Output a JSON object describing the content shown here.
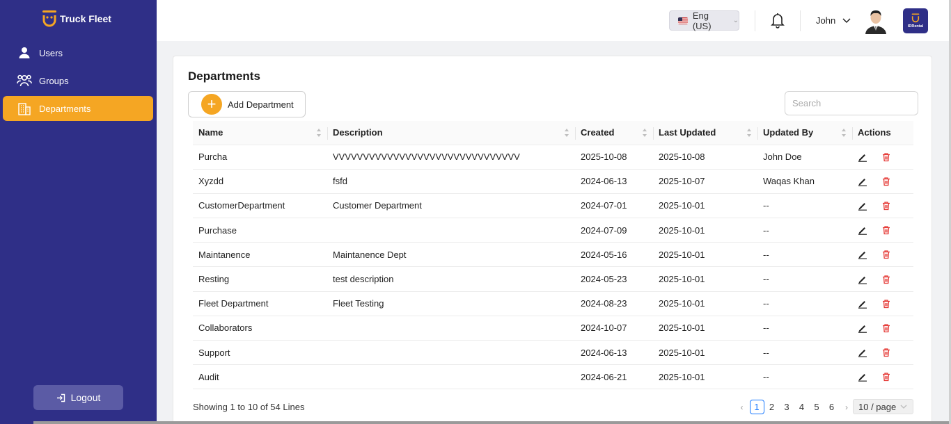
{
  "sidebar": {
    "brand": "Truck Fleet",
    "items": [
      {
        "label": "Users",
        "icon": "user-icon"
      },
      {
        "label": "Groups",
        "icon": "groups-icon"
      },
      {
        "label": "Departments",
        "icon": "building-icon",
        "active": true
      }
    ],
    "logout_label": "Logout"
  },
  "header": {
    "language": "Eng (US)",
    "user_name": "John",
    "badge_label": "IDRental"
  },
  "page": {
    "title": "Departments",
    "add_button_label": "Add Department",
    "search_placeholder": "Search"
  },
  "table": {
    "columns": [
      "Name",
      "Description",
      "Created",
      "Last Updated",
      "Updated By",
      "Actions"
    ],
    "rows": [
      {
        "name": "Purcha",
        "description": "VVVVVVVVVVVVVVVVVVVVVVVVVVVVVVV",
        "created": "2025-10-08",
        "updated": "2025-10-08",
        "updated_by": "John Doe"
      },
      {
        "name": "Xyzdd",
        "description": "fsfd",
        "created": "2024-06-13",
        "updated": "2025-10-07",
        "updated_by": "Waqas Khan"
      },
      {
        "name": "CustomerDepartment",
        "description": "Customer Department",
        "created": "2024-07-01",
        "updated": "2025-10-01",
        "updated_by": "--"
      },
      {
        "name": "Purchase",
        "description": "",
        "created": "2024-07-09",
        "updated": "2025-10-01",
        "updated_by": "--"
      },
      {
        "name": "Maintanence",
        "description": "Maintanence Dept",
        "created": "2024-05-16",
        "updated": "2025-10-01",
        "updated_by": "--"
      },
      {
        "name": "Resting",
        "description": "test description",
        "created": "2024-05-23",
        "updated": "2025-10-01",
        "updated_by": "--"
      },
      {
        "name": "Fleet Department",
        "description": "Fleet Testing",
        "created": "2024-08-23",
        "updated": "2025-10-01",
        "updated_by": "--"
      },
      {
        "name": "Collaborators",
        "description": "",
        "created": "2024-10-07",
        "updated": "2025-10-01",
        "updated_by": "--"
      },
      {
        "name": "Support",
        "description": "",
        "created": "2024-06-13",
        "updated": "2025-10-01",
        "updated_by": "--"
      },
      {
        "name": "Audit",
        "description": "",
        "created": "2024-06-21",
        "updated": "2025-10-01",
        "updated_by": "--"
      }
    ]
  },
  "footer": {
    "showing": "Showing 1 to 10 of 54 Lines",
    "pages": [
      "1",
      "2",
      "3",
      "4",
      "5",
      "6"
    ],
    "current_page": "1",
    "page_size": "10 / page"
  },
  "colors": {
    "sidebar_bg": "#2f2f87",
    "accent": "#f5a623",
    "delete": "#e53935",
    "pagination_active": "#1677ff"
  }
}
